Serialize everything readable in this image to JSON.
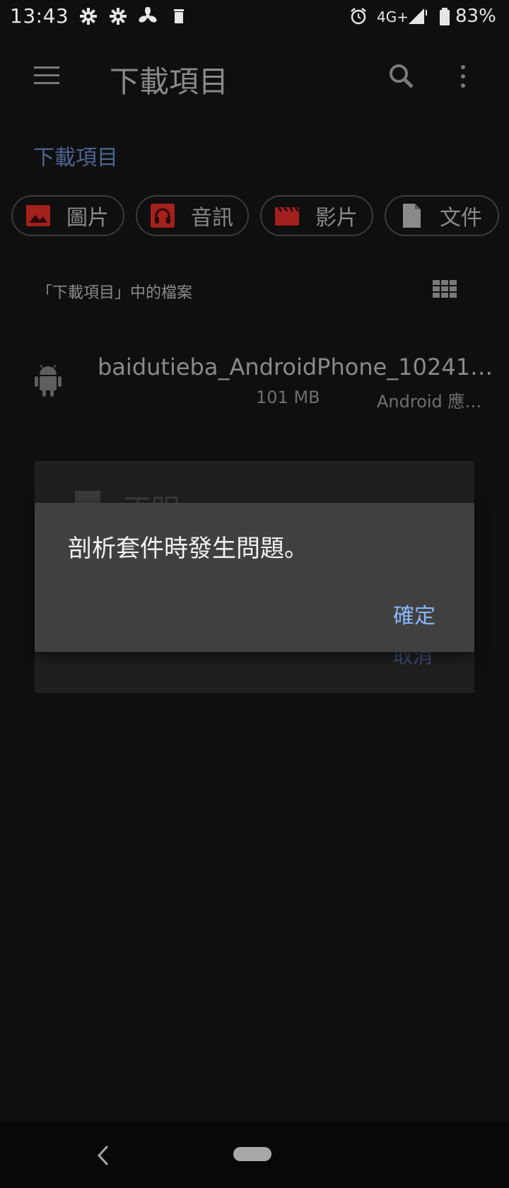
{
  "status_bar": {
    "time": "13:43",
    "network": "4G+",
    "battery": "83%",
    "left_icons": [
      "settings-icon",
      "settings-icon",
      "fan-icon",
      "trash-icon"
    ],
    "right_icons": [
      "alarm-icon",
      "signal-icon",
      "battery-icon"
    ]
  },
  "app_bar": {
    "title": "下載項目",
    "menu_icon": "menu-icon",
    "search_icon": "search-icon",
    "more_icon": "more-vert-icon"
  },
  "section_title": "下載項目",
  "chips": [
    {
      "label": "圖片",
      "icon": "image-icon"
    },
    {
      "label": "音訊",
      "icon": "headphones-icon"
    },
    {
      "label": "影片",
      "icon": "movie-icon"
    },
    {
      "label": "文件",
      "icon": "document-icon"
    }
  ],
  "files_label": "「下載項目」中的檔案",
  "file": {
    "name": "baidutieba_AndroidPhone_10241…",
    "size": "101 MB",
    "type": "Android 應…",
    "icon": "android-icon"
  },
  "background_dialog": {
    "title": "不明",
    "cancel_label": "取消"
  },
  "dialog": {
    "message": "剖析套件時發生問題。",
    "ok_label": "確定"
  },
  "colors": {
    "accent": "#8ab4f8",
    "chip_red": "#a3201c",
    "background": "#0f0f10",
    "dialog_bg": "#404040"
  }
}
